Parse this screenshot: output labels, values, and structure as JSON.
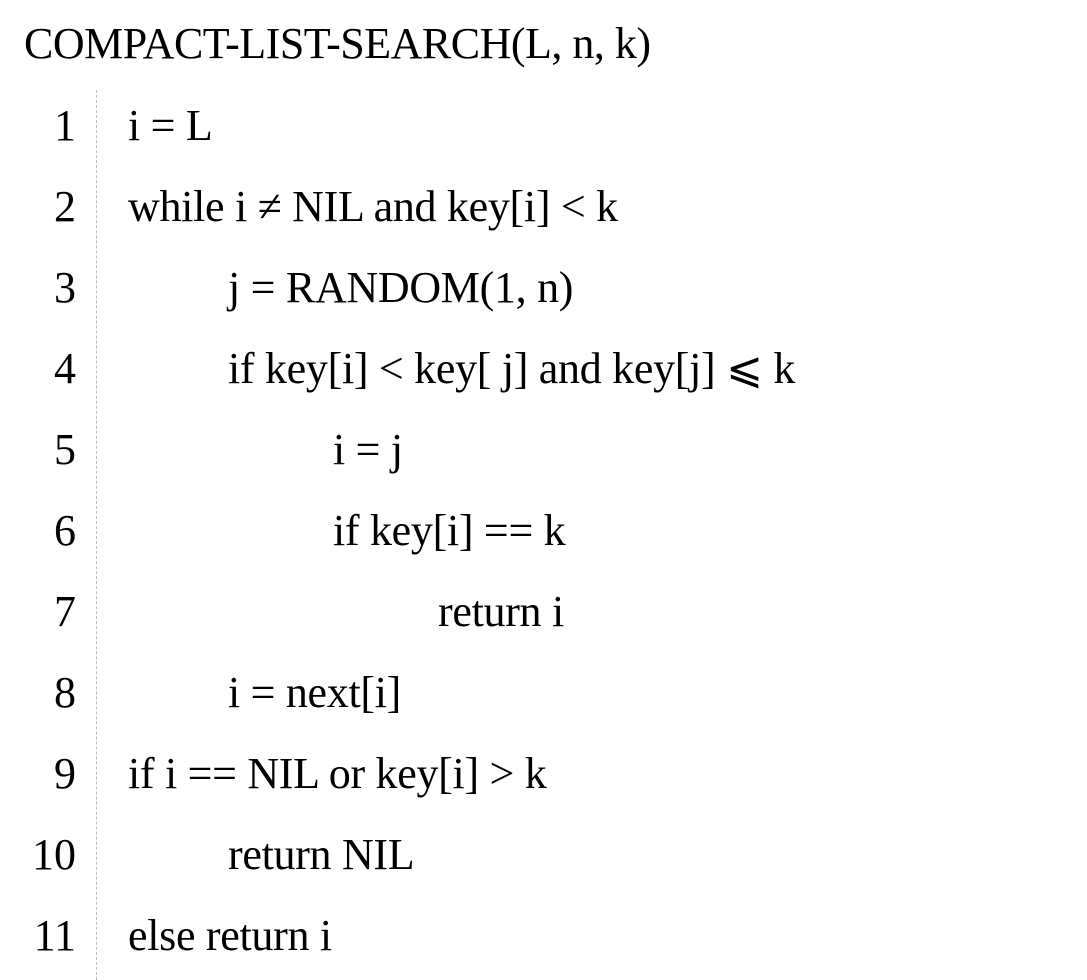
{
  "document": {
    "title": "COMPACT-LIST-SEARCH(L, n, k)",
    "lines": [
      {
        "num": "1",
        "text": "i = L"
      },
      {
        "num": "2",
        "text": "while i ≠ NIL and key[i] < k"
      },
      {
        "num": "3",
        "text": "j = RANDOM(1, n)"
      },
      {
        "num": "4",
        "text": "if key[i] < key[ j] and key[j] ⩽ k"
      },
      {
        "num": "5",
        "text": "i = j"
      },
      {
        "num": "6",
        "text": "if key[i] == k"
      },
      {
        "num": "7",
        "text": "return i"
      },
      {
        "num": "8",
        "text": "i = next[i]"
      },
      {
        "num": "9",
        "text": "if i == NIL or key[i] > k"
      },
      {
        "num": "10",
        "text": "return NIL"
      },
      {
        "num": "11",
        "text": "else return i"
      }
    ]
  }
}
